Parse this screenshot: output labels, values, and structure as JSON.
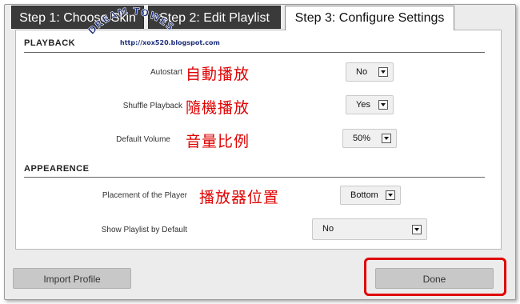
{
  "tabs": [
    {
      "label": "Step 1: Choose Skin"
    },
    {
      "label": "Step 2: Edit Playlist"
    },
    {
      "label": "Step 3: Configure Settings"
    }
  ],
  "watermark": {
    "arc_text": "DREAM TOWES",
    "url": "http://xox520.blogspot.com"
  },
  "playback": {
    "title": "PLAYBACK",
    "autostart": {
      "label": "Autostart",
      "note": "自動播放",
      "value": "No"
    },
    "shuffle": {
      "label": "Shuffle Playback",
      "note": "隨機播放",
      "value": "Yes"
    },
    "volume": {
      "label": "Default Volume",
      "note": "音量比例",
      "value": "50%"
    }
  },
  "appearance": {
    "title": "APPEARENCE",
    "placement": {
      "label": "Placement of the Player",
      "note": "播放器位置",
      "value": "Bottom"
    },
    "show_playlist": {
      "label": "Show Playlist by Default",
      "value": "No"
    }
  },
  "footer": {
    "import_label": "Import Profile",
    "done_label": "Done"
  },
  "colors": {
    "tab_active_bg": "#ffffff",
    "tab_inactive_bg": "#3a3a3a",
    "note_color": "#e00000",
    "highlight": "#e00000",
    "watermark": "#1d2f7a"
  }
}
